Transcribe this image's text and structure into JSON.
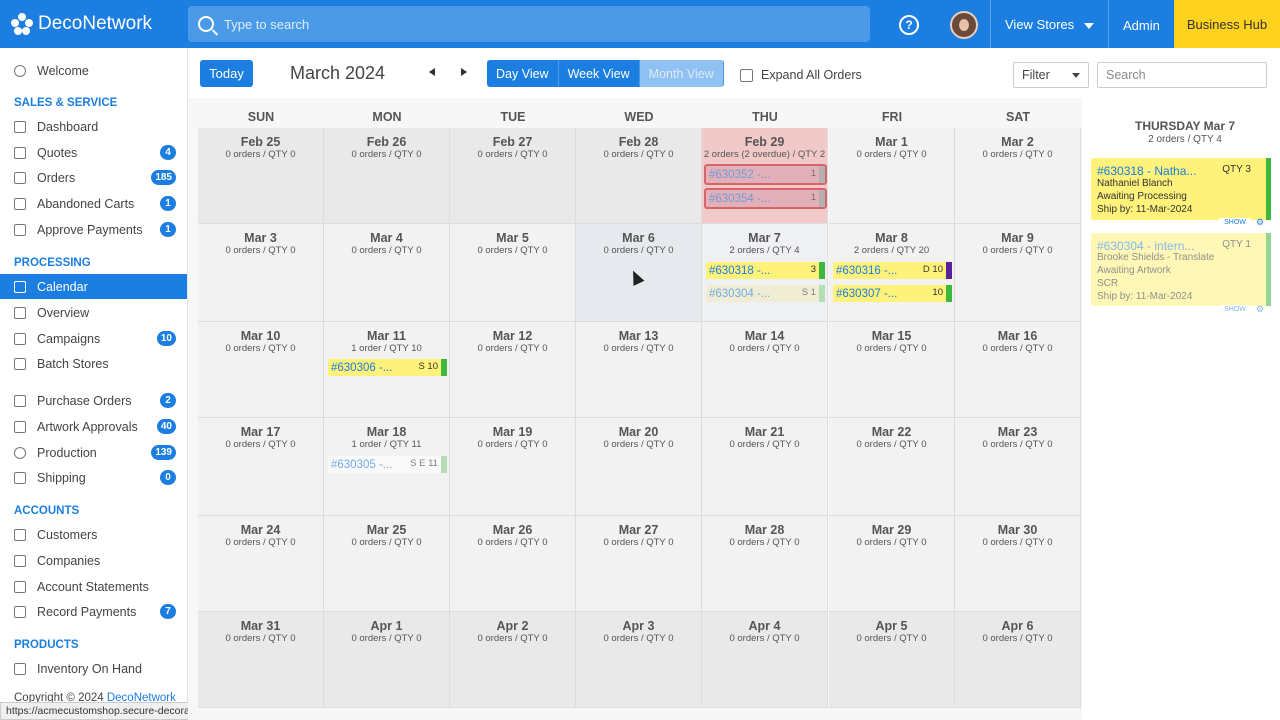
{
  "header": {
    "logo_text": "DecoNetwork",
    "search_placeholder": "Type to search",
    "help_glyph": "?",
    "view_stores": "View Stores",
    "admin": "Admin",
    "business_hub": "Business Hub"
  },
  "sidebar": {
    "welcome": "Welcome",
    "sections": {
      "sales": "SALES & SERVICE",
      "processing": "PROCESSING",
      "accounts": "ACCOUNTS",
      "products": "PRODUCTS"
    },
    "items": [
      {
        "label": "Dashboard",
        "badge": ""
      },
      {
        "label": "Quotes",
        "badge": "4"
      },
      {
        "label": "Orders",
        "badge": "185"
      },
      {
        "label": "Abandoned Carts",
        "badge": "1"
      },
      {
        "label": "Approve Payments",
        "badge": "1"
      },
      {
        "label": "Calendar",
        "badge": ""
      },
      {
        "label": "Overview",
        "badge": ""
      },
      {
        "label": "Campaigns",
        "badge": "10"
      },
      {
        "label": "Batch Stores",
        "badge": ""
      },
      {
        "label": "Purchase Orders",
        "badge": "2"
      },
      {
        "label": "Artwork Approvals",
        "badge": "40"
      },
      {
        "label": "Production",
        "badge": "139"
      },
      {
        "label": "Shipping",
        "badge": "0"
      },
      {
        "label": "Customers",
        "badge": ""
      },
      {
        "label": "Companies",
        "badge": ""
      },
      {
        "label": "Account Statements",
        "badge": ""
      },
      {
        "label": "Record Payments",
        "badge": "7"
      },
      {
        "label": "Inventory On Hand",
        "badge": ""
      }
    ],
    "copyright_prefix": "Copyright © 2024 ",
    "copyright_link": "DecoNetwork"
  },
  "status_url": "https://acmecustomshop.secure-decoration.com/bh/orders#",
  "toolbar": {
    "today": "Today",
    "month_title": "March 2024",
    "views": [
      "Day View",
      "Week View",
      "Month View"
    ],
    "expand_label": "Expand All Orders",
    "filter_label": "Filter",
    "search_placeholder": "Search"
  },
  "calendar": {
    "day_headers": [
      "SUN",
      "MON",
      "TUE",
      "WED",
      "THU",
      "FRI",
      "SAT"
    ],
    "weeks": [
      [
        {
          "date": "Feb 25",
          "summary": "0 orders / QTY 0"
        },
        {
          "date": "Feb 26",
          "summary": "0 orders / QTY 0"
        },
        {
          "date": "Feb 27",
          "summary": "0 orders / QTY 0"
        },
        {
          "date": "Feb 28",
          "summary": "0 orders / QTY 0"
        },
        {
          "date": "Feb 29",
          "summary": "2 orders (2 overdue) / QTY 2"
        },
        {
          "date": "Mar 1",
          "summary": "0 orders / QTY 0"
        },
        {
          "date": "Mar 2",
          "summary": "0 orders / QTY 0"
        }
      ],
      [
        {
          "date": "Mar 3",
          "summary": "0 orders / QTY 0"
        },
        {
          "date": "Mar 4",
          "summary": "0 orders / QTY 0"
        },
        {
          "date": "Mar 5",
          "summary": "0 orders / QTY 0"
        },
        {
          "date": "Mar 6",
          "summary": "0 orders / QTY 0"
        },
        {
          "date": "Mar 7",
          "summary": "2 orders / QTY 4"
        },
        {
          "date": "Mar 8",
          "summary": "2 orders / QTY 20"
        },
        {
          "date": "Mar 9",
          "summary": "0 orders / QTY 0"
        }
      ],
      [
        {
          "date": "Mar 10",
          "summary": "0 orders / QTY 0"
        },
        {
          "date": "Mar 11",
          "summary": "1 order / QTY 10"
        },
        {
          "date": "Mar 12",
          "summary": "0 orders / QTY 0"
        },
        {
          "date": "Mar 13",
          "summary": "0 orders / QTY 0"
        },
        {
          "date": "Mar 14",
          "summary": "0 orders / QTY 0"
        },
        {
          "date": "Mar 15",
          "summary": "0 orders / QTY 0"
        },
        {
          "date": "Mar 16",
          "summary": "0 orders / QTY 0"
        }
      ],
      [
        {
          "date": "Mar 17",
          "summary": "0 orders / QTY 0"
        },
        {
          "date": "Mar 18",
          "summary": "1 order / QTY 11"
        },
        {
          "date": "Mar 19",
          "summary": "0 orders / QTY 0"
        },
        {
          "date": "Mar 20",
          "summary": "0 orders / QTY 0"
        },
        {
          "date": "Mar 21",
          "summary": "0 orders / QTY 0"
        },
        {
          "date": "Mar 22",
          "summary": "0 orders / QTY 0"
        },
        {
          "date": "Mar 23",
          "summary": "0 orders / QTY 0"
        }
      ],
      [
        {
          "date": "Mar 24",
          "summary": "0 orders / QTY 0"
        },
        {
          "date": "Mar 25",
          "summary": "0 orders / QTY 0"
        },
        {
          "date": "Mar 26",
          "summary": "0 orders / QTY 0"
        },
        {
          "date": "Mar 27",
          "summary": "0 orders / QTY 0"
        },
        {
          "date": "Mar 28",
          "summary": "0 orders / QTY 0"
        },
        {
          "date": "Mar 29",
          "summary": "0 orders / QTY 0"
        },
        {
          "date": "Mar 30",
          "summary": "0 orders / QTY 0"
        }
      ],
      [
        {
          "date": "Mar 31",
          "summary": "0 orders / QTY 0"
        },
        {
          "date": "Apr 1",
          "summary": "0 orders / QTY 0"
        },
        {
          "date": "Apr 2",
          "summary": "0 orders / QTY 0"
        },
        {
          "date": "Apr 3",
          "summary": "0 orders / QTY 0"
        },
        {
          "date": "Apr 4",
          "summary": "0 orders / QTY 0"
        },
        {
          "date": "Apr 5",
          "summary": "0 orders / QTY 0"
        },
        {
          "date": "Apr 6",
          "summary": "0 orders / QTY 0"
        }
      ]
    ],
    "orders": {
      "feb29_a": {
        "number": "#630352 -...",
        "qty": "1"
      },
      "feb29_b": {
        "number": "#630354 -...",
        "qty": "1"
      },
      "mar7_a": {
        "number": "#630318 -...",
        "qty": "3"
      },
      "mar7_b": {
        "number": "#630304 -...",
        "qty": "S 1"
      },
      "mar8_a": {
        "number": "#630316 -...",
        "qty": "D 10"
      },
      "mar8_b": {
        "number": "#630307 -...",
        "qty": "10"
      },
      "mar11_a": {
        "number": "#630306 -...",
        "qty": "S 10"
      },
      "mar18_a": {
        "number": "#630305 -...",
        "qty": "S E 11"
      }
    },
    "colors": {
      "yellow": "#fff27a",
      "green": "#3db83d",
      "purple": "#5a1f9a",
      "overdue_border": "#c9222a",
      "light_green": "#8fd18f"
    }
  },
  "detail_panel": {
    "title": "THURSDAY Mar 7",
    "subtitle": "2 orders / QTY 4",
    "cards": [
      {
        "number": "#630318 - Natha...",
        "qty": "QTY 3",
        "customer": "Nathaniel Blanch",
        "status": "Awaiting Processing",
        "ship": "Ship by: 11-Mar-2024",
        "show": "SHOW"
      },
      {
        "number": "#630304 - intern...",
        "qty": "QTY 1",
        "customer": "Brooke Shields - Translate",
        "status": "Awaiting Artwork",
        "extra": "SCR",
        "ship": "Ship by: 11-Mar-2024",
        "show": "SHOW"
      }
    ]
  }
}
